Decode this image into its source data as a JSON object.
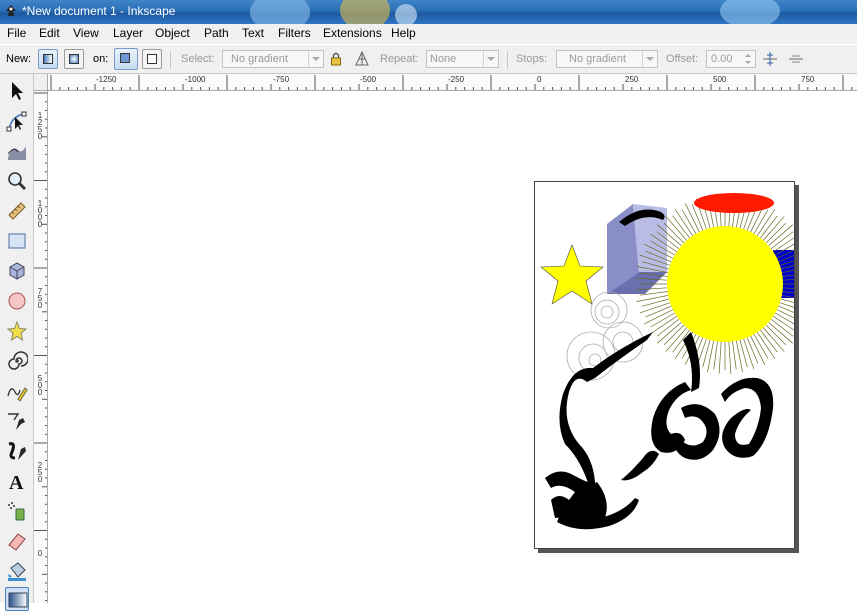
{
  "window": {
    "title": "*New document 1 - Inkscape",
    "app_icon": "inkscape-icon"
  },
  "menu": [
    "File",
    "Edit",
    "View",
    "Layer",
    "Object",
    "Path",
    "Text",
    "Filters",
    "Extensions",
    "Help"
  ],
  "toolbar": {
    "new_label": "New:",
    "on_label": "on:",
    "select_label": "Select:",
    "select_value": "No gradient",
    "repeat_label": "Repeat:",
    "repeat_value": "None",
    "stops_label": "Stops:",
    "stops_value": "No gradient",
    "offset_label": "Offset:",
    "offset_value": "0.00"
  },
  "rulers": {
    "horizontal": [
      "-1250",
      "-1000",
      "-750",
      "-500",
      "-250",
      "0",
      "250",
      "500",
      "750"
    ],
    "vertical": [
      "1250",
      "1000",
      "750",
      "500",
      "250",
      "0"
    ]
  },
  "tools": [
    "selector-tool-icon",
    "node-tool-icon",
    "tweak-tool-icon",
    "zoom-tool-icon",
    "measure-tool-icon",
    "rect-tool-icon",
    "3dbox-tool-icon",
    "ellipse-tool-icon",
    "star-tool-icon",
    "spiral-tool-icon",
    "pencil-tool-icon",
    "pen-tool-icon",
    "calligraphy-tool-icon",
    "text-tool-icon",
    "spray-tool-icon",
    "eraser-tool-icon",
    "paint-bucket-tool-icon",
    "gradient-tool-icon"
  ],
  "colors": {
    "sun": "#ffff00",
    "star": "#ffff00",
    "ellipse": "#ff0000",
    "rect": "#0000cc",
    "box": "#8080c0"
  }
}
